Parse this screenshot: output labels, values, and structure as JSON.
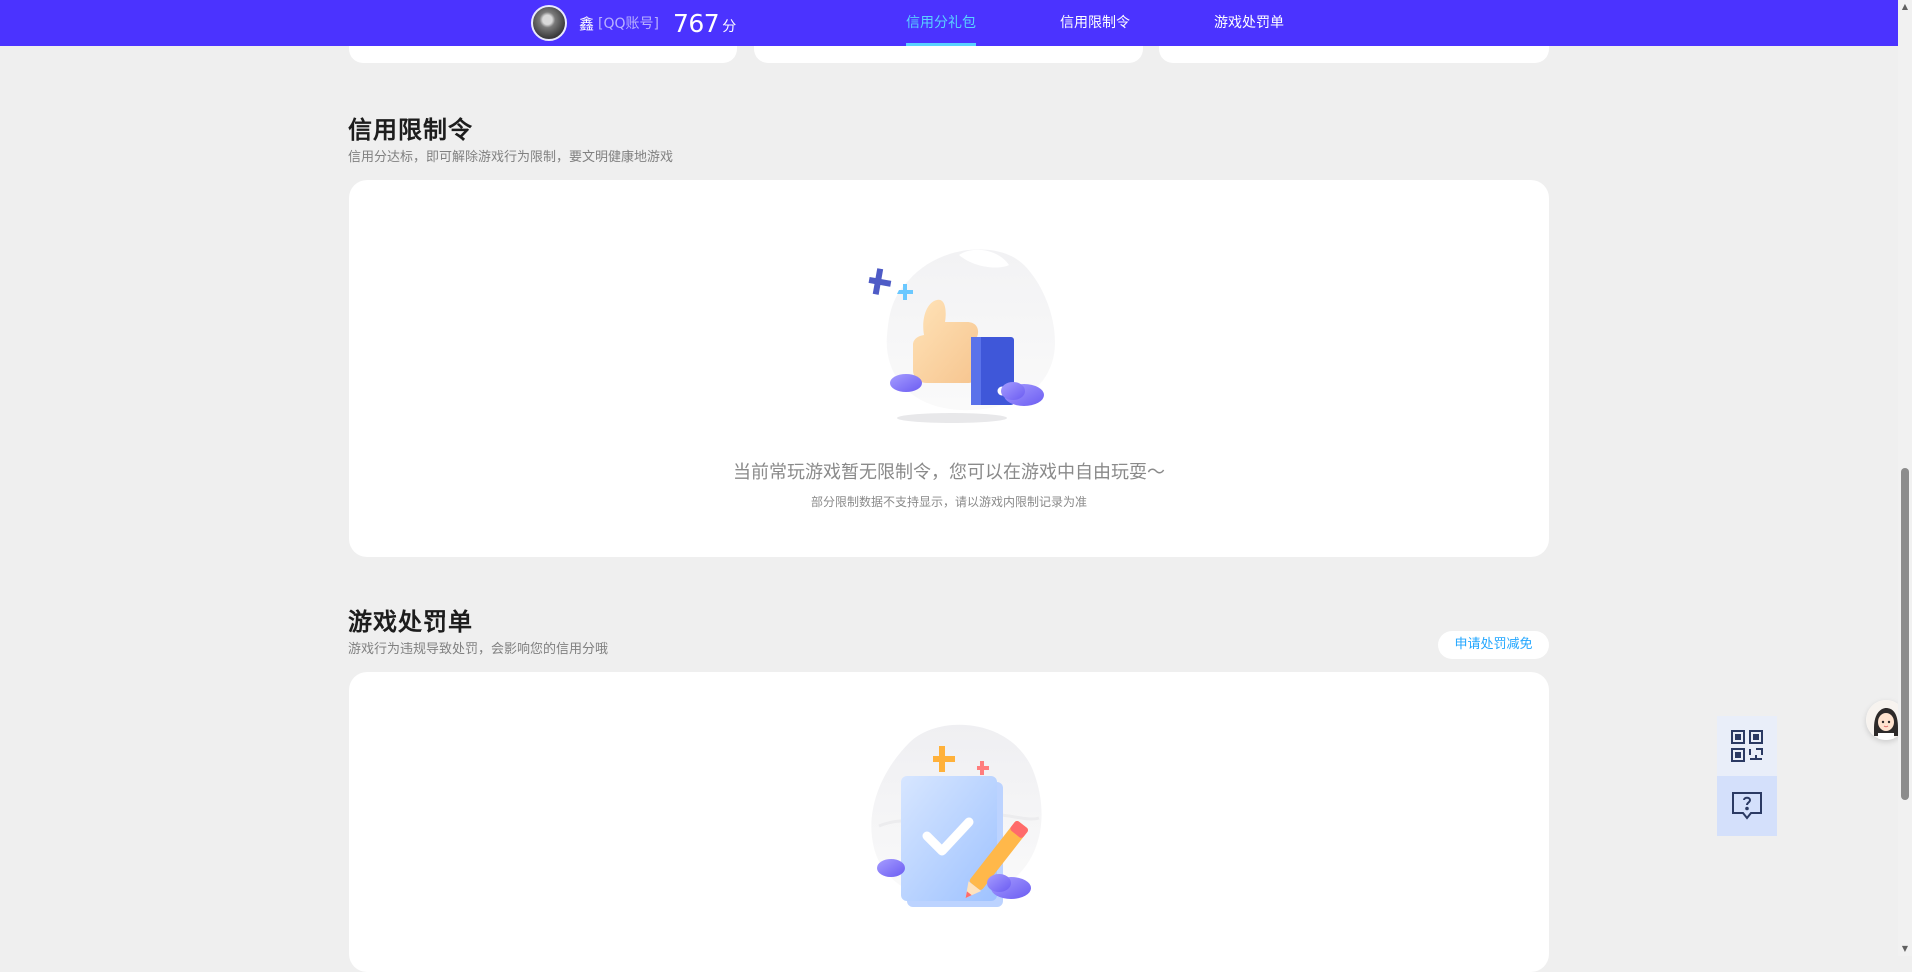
{
  "header": {
    "username": "鑫",
    "account_type": "[QQ账号]",
    "score": "767",
    "score_unit": "分",
    "tabs": [
      {
        "label": "信用分礼包",
        "active": true
      },
      {
        "label": "信用限制令",
        "active": false
      },
      {
        "label": "游戏处罚单",
        "active": false
      }
    ]
  },
  "restriction_section": {
    "title": "信用限制令",
    "subtitle": "信用分达标，即可解除游戏行为限制，要文明健康地游戏",
    "empty_title": "当前常玩游戏暂无限制令，您可以在游戏中自由玩耍～",
    "empty_note": "部分限制数据不支持显示，请以游戏内限制记录为准",
    "illustration": "thumbs-up-icon"
  },
  "penalty_section": {
    "title": "游戏处罚单",
    "subtitle": "游戏行为违规导致处罚，会影响您的信用分哦",
    "appeal_button": "申请处罚减免",
    "illustration": "clipboard-check-icon"
  },
  "floating": {
    "qr_icon": "qr-code-icon",
    "help_icon": "help-chat-icon",
    "support_icon": "customer-service-avatar"
  },
  "colors": {
    "brand": "#4b33ff",
    "accent": "#59d2ff",
    "link": "#21a6ff",
    "background": "#efefef"
  }
}
